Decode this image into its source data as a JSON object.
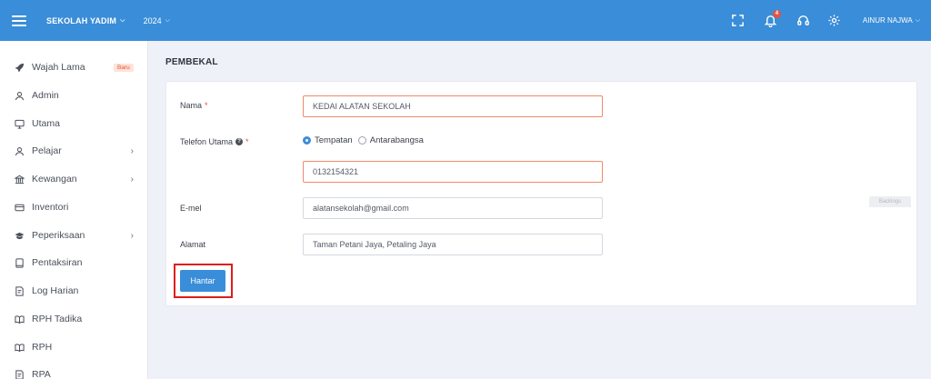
{
  "header": {
    "school": "SEKOLAH YADIM",
    "year": "2024",
    "notification_count": "4",
    "user": "AINUR NAJWA"
  },
  "sidebar": {
    "items": [
      {
        "label": "Wajah Lama",
        "badge": "Baru",
        "icon": "rocket-icon"
      },
      {
        "label": "Admin",
        "icon": "user-icon"
      },
      {
        "label": "Utama",
        "icon": "monitor-icon"
      },
      {
        "label": "Pelajar",
        "icon": "user-icon",
        "has_children": true
      },
      {
        "label": "Kewangan",
        "icon": "bank-icon",
        "has_children": true
      },
      {
        "label": "Inventori",
        "icon": "card-icon"
      },
      {
        "label": "Peperiksaan",
        "icon": "graduation-cap-icon",
        "has_children": true
      },
      {
        "label": "Pentaksiran",
        "icon": "book-icon"
      },
      {
        "label": "Log Harian",
        "icon": "notebook-icon"
      },
      {
        "label": "RPH Tadika",
        "icon": "open-book-icon"
      },
      {
        "label": "RPH",
        "icon": "open-book-icon"
      },
      {
        "label": "RPA",
        "icon": "notebook-icon"
      }
    ],
    "arrow": "›"
  },
  "page": {
    "title": "PEMBEKAL"
  },
  "form": {
    "name_label": "Nama",
    "name_value": "KEDAI ALATAN SEKOLAH",
    "phone_label": "Telefon Utama",
    "phone_options": [
      "Tempatan",
      "Antarabangsa"
    ],
    "phone_selected": "Tempatan",
    "phone_value": "0132154321",
    "email_label": "E-mel",
    "email_value": "alatansekolah@gmail.com",
    "address_label": "Alamat",
    "address_value": "Taman Petani Jaya, Petaling Jaya",
    "required_mark": "*",
    "submit_label": "Hantar",
    "side_tag": "Backlogs"
  },
  "colors": {
    "accent": "#3a8dd8",
    "error": "#e5533d",
    "highlight": "#e01c1c"
  }
}
